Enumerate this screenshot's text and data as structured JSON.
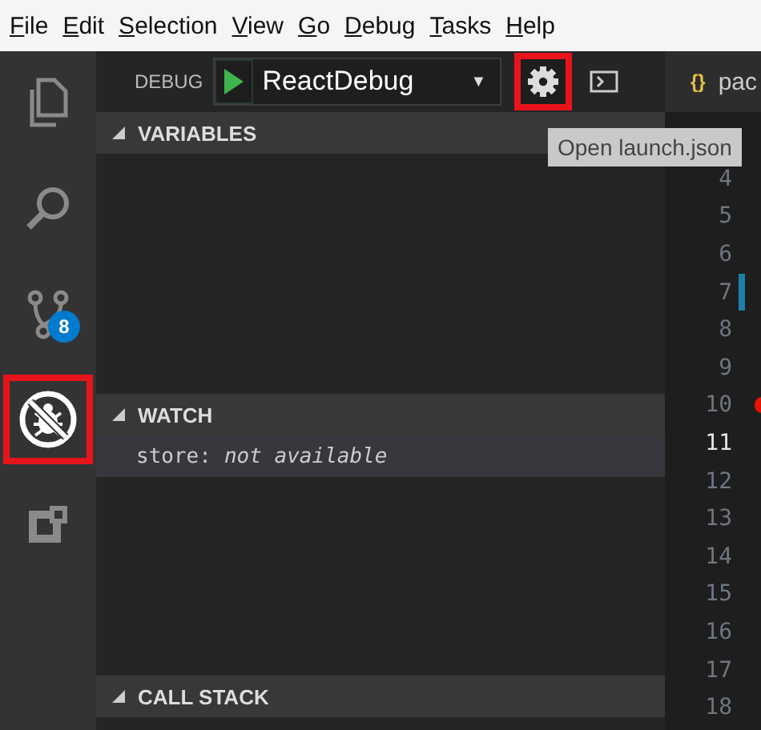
{
  "menu": [
    {
      "label": "File"
    },
    {
      "label": "Edit"
    },
    {
      "label": "Selection"
    },
    {
      "label": "View"
    },
    {
      "label": "Go"
    },
    {
      "label": "Debug"
    },
    {
      "label": "Tasks"
    },
    {
      "label": "Help"
    }
  ],
  "activity_bar": [
    {
      "kind": "files",
      "selected": false,
      "highlighted": false
    },
    {
      "kind": "search",
      "selected": false,
      "highlighted": false
    },
    {
      "kind": "source-control",
      "selected": false,
      "highlighted": false,
      "badge": "8"
    },
    {
      "kind": "debug",
      "selected": true,
      "highlighted": true
    },
    {
      "kind": "extensions",
      "selected": false,
      "highlighted": false
    }
  ],
  "debug_toolbar": {
    "label": "DEBUG",
    "configuration": "ReactDebug",
    "caret": "▼",
    "settings_highlighted": true
  },
  "tooltip": "Open launch.json",
  "sections": [
    {
      "title": "VARIABLES",
      "expanded": true
    },
    {
      "title": "WATCH",
      "expanded": true,
      "items": [
        {
          "name": "store:",
          "value": "not available"
        }
      ]
    },
    {
      "title": "CALL STACK",
      "expanded": true
    }
  ],
  "editor": {
    "tab": {
      "icon": "{}",
      "label": "pac"
    },
    "lines": [
      {
        "number": "4",
        "current": false,
        "modified": false,
        "breakpoint": false
      },
      {
        "number": "5",
        "current": false,
        "modified": false,
        "breakpoint": false
      },
      {
        "number": "6",
        "current": false,
        "modified": false,
        "breakpoint": false
      },
      {
        "number": "7",
        "current": false,
        "modified": true,
        "breakpoint": false
      },
      {
        "number": "8",
        "current": false,
        "modified": false,
        "breakpoint": false
      },
      {
        "number": "9",
        "current": false,
        "modified": false,
        "breakpoint": false
      },
      {
        "number": "10",
        "current": false,
        "modified": false,
        "breakpoint": true
      },
      {
        "number": "11",
        "current": true,
        "modified": false,
        "breakpoint": false
      },
      {
        "number": "12",
        "current": false,
        "modified": false,
        "breakpoint": false
      },
      {
        "number": "13",
        "current": false,
        "modified": false,
        "breakpoint": false
      },
      {
        "number": "14",
        "current": false,
        "modified": false,
        "breakpoint": false
      },
      {
        "number": "15",
        "current": false,
        "modified": false,
        "breakpoint": false
      },
      {
        "number": "16",
        "current": false,
        "modified": false,
        "breakpoint": false
      },
      {
        "number": "17",
        "current": false,
        "modified": false,
        "breakpoint": false
      },
      {
        "number": "18",
        "current": false,
        "modified": false,
        "breakpoint": false
      }
    ]
  }
}
